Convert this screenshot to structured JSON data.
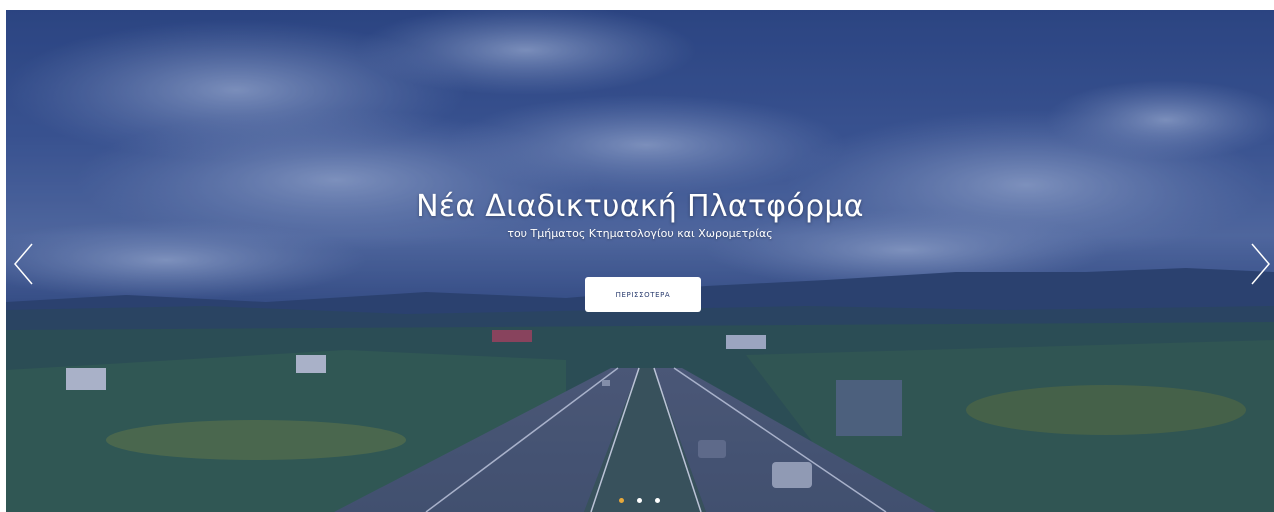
{
  "hero": {
    "title": "Νέα Διαδικτυακή Πλατφόρμα",
    "subtitle": "του Τμήματος Κτηματολογίου και Χωρομετρίας",
    "button_label": "ΠΕΡΙΣΣΟΤΕΡΑ"
  },
  "carousel": {
    "prev_icon": "chevron-left-icon",
    "next_icon": "chevron-right-icon",
    "slide_count": 3,
    "active_slide": 1
  },
  "colors": {
    "overlay": "#2f4a86",
    "active_dot": "#e8a93b",
    "inactive_dot": "#ffffff",
    "button_text": "#2a3c6e"
  }
}
